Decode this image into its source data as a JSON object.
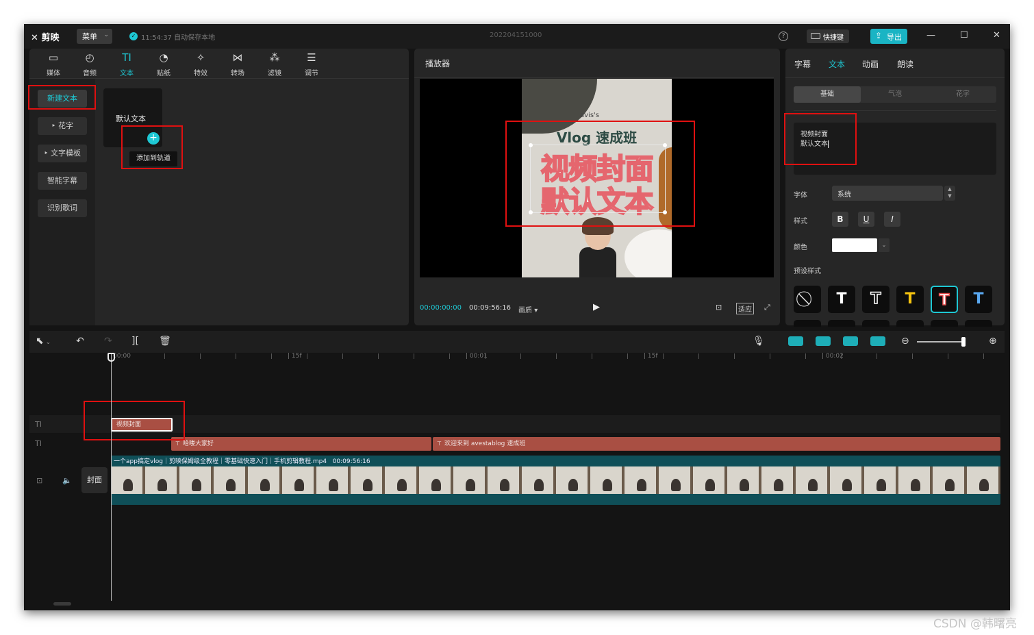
{
  "app": {
    "logo": "剪映",
    "menu_label": "菜单",
    "autosave": "11:54:37 自动保存本地",
    "project_title": "202204151000",
    "shortcut_label": "快捷键",
    "export_label": "导出",
    "help": "?",
    "win_min": "—",
    "win_max": "☐",
    "win_close": "✕"
  },
  "toolbar": {
    "tabs": [
      {
        "label": "媒体",
        "icon": "media-icon"
      },
      {
        "label": "音频",
        "icon": "audio-icon"
      },
      {
        "label": "文本",
        "icon": "text-icon",
        "active": true
      },
      {
        "label": "贴纸",
        "icon": "sticker-icon"
      },
      {
        "label": "特效",
        "icon": "effects-icon"
      },
      {
        "label": "转场",
        "icon": "transition-icon"
      },
      {
        "label": "滤镜",
        "icon": "filter-icon"
      },
      {
        "label": "调节",
        "icon": "adjust-icon"
      }
    ]
  },
  "sidebar": {
    "items": [
      "新建文本",
      "花字",
      "文字模板",
      "智能字幕",
      "识别歌词"
    ]
  },
  "text_panel": {
    "card_label": "默认文本",
    "add_tooltip": "添加到轨道"
  },
  "player": {
    "title": "播放器",
    "current_time": "00:00:00:00",
    "duration": "00:09:56:16",
    "quality": "画质",
    "fit_label": "适应",
    "overlay": {
      "watermark": "avis's",
      "subtitle": "Vlog 速成班",
      "line1": "视频封面",
      "line2": "默认文本"
    }
  },
  "right_panel": {
    "tabs": [
      "字幕",
      "文本",
      "动画",
      "朗读"
    ],
    "active_tab": "文本",
    "sub_tabs": [
      "基础",
      "气泡",
      "花字"
    ],
    "text_lines": [
      "视频封面",
      "默认文本"
    ],
    "font_label": "字体",
    "font_value": "系统",
    "style_label": "样式",
    "style_buttons": [
      "B",
      "U",
      "I"
    ],
    "color_label": "颜色",
    "color_value": "#ffffff",
    "preset_label": "预设样式",
    "presets": [
      "T",
      "T",
      "T",
      "T",
      "T"
    ]
  },
  "timeline": {
    "ruler": [
      "00:00",
      "15f",
      "00:01",
      "15f",
      "00:02"
    ],
    "clips": {
      "text_a": "视频封面",
      "text_b": "哈喽大家好",
      "text_c": "欢迎来到 avestablog 速成班"
    },
    "video_clip": {
      "name": "一个app搞定vlog｜剪映保姆级全教程｜零基础快速入门｜手机剪辑教程.mp4",
      "duration": "00:09:56:16"
    },
    "cover_label": "封面"
  },
  "watermark": "CSDN @韩曙亮",
  "colors": {
    "accent": "#1ec8d4",
    "text_clip": "#a94f43",
    "video_clip": "#0f4f58",
    "annotation": "#e01010"
  }
}
